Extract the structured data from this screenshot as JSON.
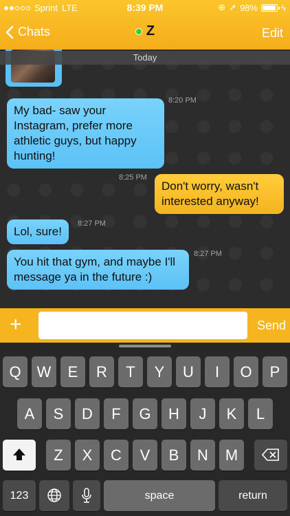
{
  "status_bar": {
    "carrier": "Sprint",
    "network": "LTE",
    "time": "8:39 PM",
    "battery": "98%"
  },
  "nav": {
    "back_label": "Chats",
    "contact_name": "Z",
    "edit_label": "Edit",
    "accent_color": "#f4ad1c",
    "online_color": "#33d21e"
  },
  "chat": {
    "date_separator": "Today",
    "messages": [
      {
        "side": "in",
        "text": "My bad- saw your Instagram, prefer more athletic guys, but happy hunting!",
        "time": "8:20 PM"
      },
      {
        "side": "out",
        "text": "Don't worry, wasn't interested anyway!",
        "time": "8:25 PM"
      },
      {
        "side": "in",
        "text": "Lol, sure!",
        "time": "8:27 PM"
      },
      {
        "side": "in",
        "text": "You hit that gym, and maybe I'll message ya in the future :)",
        "time": "8:27 PM"
      }
    ]
  },
  "composer": {
    "plus_label": "+",
    "placeholder": "",
    "send_label": "Send"
  },
  "keyboard": {
    "row1": [
      "Q",
      "W",
      "E",
      "R",
      "T",
      "Y",
      "U",
      "I",
      "O",
      "P"
    ],
    "row2": [
      "A",
      "S",
      "D",
      "F",
      "G",
      "H",
      "J",
      "K",
      "L"
    ],
    "row3": [
      "Z",
      "X",
      "C",
      "V",
      "B",
      "N",
      "M"
    ],
    "numbers_label": "123",
    "space_label": "space",
    "return_label": "return",
    "icons": [
      "shift-icon",
      "backspace-icon",
      "globe-icon",
      "microphone-icon"
    ]
  }
}
